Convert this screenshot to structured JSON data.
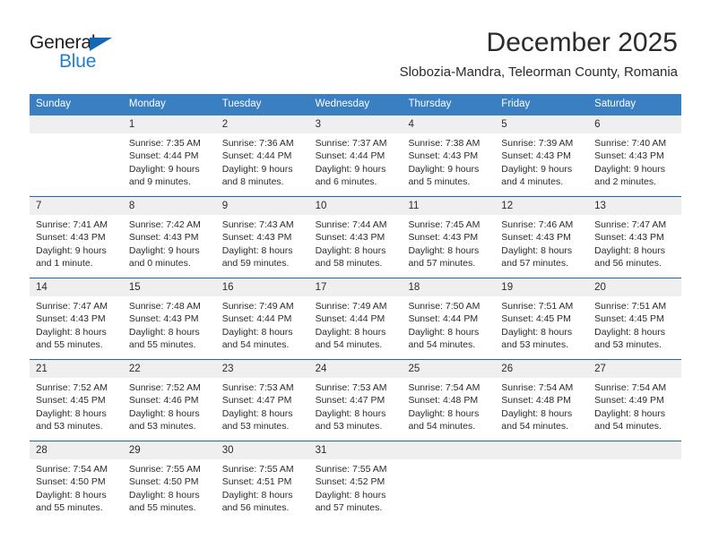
{
  "brand": {
    "name_top": "General",
    "name_bottom": "Blue",
    "color_dark": "#231f20",
    "color_blue": "#1f7fd0",
    "triangle_color": "#1268b3"
  },
  "header": {
    "title": "December 2025",
    "subtitle": "Slobozia-Mandra, Teleorman County, Romania"
  },
  "theme": {
    "header_row_bg": "#3a7fc1",
    "header_row_text": "#ffffff",
    "date_band_bg": "#efefef",
    "week_divider": "#1f67ab",
    "body_text": "#2b2b2b"
  },
  "weekday_headers": [
    "Sunday",
    "Monday",
    "Tuesday",
    "Wednesday",
    "Thursday",
    "Friday",
    "Saturday"
  ],
  "weeks": [
    {
      "days": [
        {
          "num": "",
          "lines": []
        },
        {
          "num": "1",
          "lines": [
            "Sunrise: 7:35 AM",
            "Sunset: 4:44 PM",
            "Daylight: 9 hours",
            "and 9 minutes."
          ]
        },
        {
          "num": "2",
          "lines": [
            "Sunrise: 7:36 AM",
            "Sunset: 4:44 PM",
            "Daylight: 9 hours",
            "and 8 minutes."
          ]
        },
        {
          "num": "3",
          "lines": [
            "Sunrise: 7:37 AM",
            "Sunset: 4:44 PM",
            "Daylight: 9 hours",
            "and 6 minutes."
          ]
        },
        {
          "num": "4",
          "lines": [
            "Sunrise: 7:38 AM",
            "Sunset: 4:43 PM",
            "Daylight: 9 hours",
            "and 5 minutes."
          ]
        },
        {
          "num": "5",
          "lines": [
            "Sunrise: 7:39 AM",
            "Sunset: 4:43 PM",
            "Daylight: 9 hours",
            "and 4 minutes."
          ]
        },
        {
          "num": "6",
          "lines": [
            "Sunrise: 7:40 AM",
            "Sunset: 4:43 PM",
            "Daylight: 9 hours",
            "and 2 minutes."
          ]
        }
      ]
    },
    {
      "days": [
        {
          "num": "7",
          "lines": [
            "Sunrise: 7:41 AM",
            "Sunset: 4:43 PM",
            "Daylight: 9 hours",
            "and 1 minute."
          ]
        },
        {
          "num": "8",
          "lines": [
            "Sunrise: 7:42 AM",
            "Sunset: 4:43 PM",
            "Daylight: 9 hours",
            "and 0 minutes."
          ]
        },
        {
          "num": "9",
          "lines": [
            "Sunrise: 7:43 AM",
            "Sunset: 4:43 PM",
            "Daylight: 8 hours",
            "and 59 minutes."
          ]
        },
        {
          "num": "10",
          "lines": [
            "Sunrise: 7:44 AM",
            "Sunset: 4:43 PM",
            "Daylight: 8 hours",
            "and 58 minutes."
          ]
        },
        {
          "num": "11",
          "lines": [
            "Sunrise: 7:45 AM",
            "Sunset: 4:43 PM",
            "Daylight: 8 hours",
            "and 57 minutes."
          ]
        },
        {
          "num": "12",
          "lines": [
            "Sunrise: 7:46 AM",
            "Sunset: 4:43 PM",
            "Daylight: 8 hours",
            "and 57 minutes."
          ]
        },
        {
          "num": "13",
          "lines": [
            "Sunrise: 7:47 AM",
            "Sunset: 4:43 PM",
            "Daylight: 8 hours",
            "and 56 minutes."
          ]
        }
      ]
    },
    {
      "days": [
        {
          "num": "14",
          "lines": [
            "Sunrise: 7:47 AM",
            "Sunset: 4:43 PM",
            "Daylight: 8 hours",
            "and 55 minutes."
          ]
        },
        {
          "num": "15",
          "lines": [
            "Sunrise: 7:48 AM",
            "Sunset: 4:43 PM",
            "Daylight: 8 hours",
            "and 55 minutes."
          ]
        },
        {
          "num": "16",
          "lines": [
            "Sunrise: 7:49 AM",
            "Sunset: 4:44 PM",
            "Daylight: 8 hours",
            "and 54 minutes."
          ]
        },
        {
          "num": "17",
          "lines": [
            "Sunrise: 7:49 AM",
            "Sunset: 4:44 PM",
            "Daylight: 8 hours",
            "and 54 minutes."
          ]
        },
        {
          "num": "18",
          "lines": [
            "Sunrise: 7:50 AM",
            "Sunset: 4:44 PM",
            "Daylight: 8 hours",
            "and 54 minutes."
          ]
        },
        {
          "num": "19",
          "lines": [
            "Sunrise: 7:51 AM",
            "Sunset: 4:45 PM",
            "Daylight: 8 hours",
            "and 53 minutes."
          ]
        },
        {
          "num": "20",
          "lines": [
            "Sunrise: 7:51 AM",
            "Sunset: 4:45 PM",
            "Daylight: 8 hours",
            "and 53 minutes."
          ]
        }
      ]
    },
    {
      "days": [
        {
          "num": "21",
          "lines": [
            "Sunrise: 7:52 AM",
            "Sunset: 4:45 PM",
            "Daylight: 8 hours",
            "and 53 minutes."
          ]
        },
        {
          "num": "22",
          "lines": [
            "Sunrise: 7:52 AM",
            "Sunset: 4:46 PM",
            "Daylight: 8 hours",
            "and 53 minutes."
          ]
        },
        {
          "num": "23",
          "lines": [
            "Sunrise: 7:53 AM",
            "Sunset: 4:47 PM",
            "Daylight: 8 hours",
            "and 53 minutes."
          ]
        },
        {
          "num": "24",
          "lines": [
            "Sunrise: 7:53 AM",
            "Sunset: 4:47 PM",
            "Daylight: 8 hours",
            "and 53 minutes."
          ]
        },
        {
          "num": "25",
          "lines": [
            "Sunrise: 7:54 AM",
            "Sunset: 4:48 PM",
            "Daylight: 8 hours",
            "and 54 minutes."
          ]
        },
        {
          "num": "26",
          "lines": [
            "Sunrise: 7:54 AM",
            "Sunset: 4:48 PM",
            "Daylight: 8 hours",
            "and 54 minutes."
          ]
        },
        {
          "num": "27",
          "lines": [
            "Sunrise: 7:54 AM",
            "Sunset: 4:49 PM",
            "Daylight: 8 hours",
            "and 54 minutes."
          ]
        }
      ]
    },
    {
      "days": [
        {
          "num": "28",
          "lines": [
            "Sunrise: 7:54 AM",
            "Sunset: 4:50 PM",
            "Daylight: 8 hours",
            "and 55 minutes."
          ]
        },
        {
          "num": "29",
          "lines": [
            "Sunrise: 7:55 AM",
            "Sunset: 4:50 PM",
            "Daylight: 8 hours",
            "and 55 minutes."
          ]
        },
        {
          "num": "30",
          "lines": [
            "Sunrise: 7:55 AM",
            "Sunset: 4:51 PM",
            "Daylight: 8 hours",
            "and 56 minutes."
          ]
        },
        {
          "num": "31",
          "lines": [
            "Sunrise: 7:55 AM",
            "Sunset: 4:52 PM",
            "Daylight: 8 hours",
            "and 57 minutes."
          ]
        },
        {
          "num": "",
          "lines": []
        },
        {
          "num": "",
          "lines": []
        },
        {
          "num": "",
          "lines": []
        }
      ]
    }
  ]
}
